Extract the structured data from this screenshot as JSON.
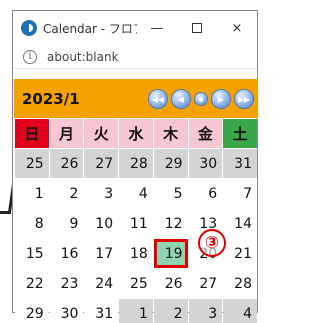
{
  "window": {
    "title": "Calendar - フロフ...",
    "minimize_glyph": "—",
    "close_glyph": "×",
    "url": "about:blank",
    "info_glyph": "i"
  },
  "calendar": {
    "month_label": "2023/1",
    "nav": {
      "first_glyph": "◀◀",
      "prev_glyph": "◀",
      "today_glyph": "●",
      "next_glyph": "▶",
      "last_glyph": "▶▶"
    },
    "weekdays": [
      "日",
      "月",
      "火",
      "水",
      "木",
      "金",
      "土"
    ],
    "weeks": [
      [
        "25",
        "26",
        "27",
        "28",
        "29",
        "30",
        "31"
      ],
      [
        "1",
        "2",
        "3",
        "4",
        "5",
        "6",
        "7"
      ],
      [
        "8",
        "9",
        "10",
        "11",
        "12",
        "13",
        "14"
      ],
      [
        "15",
        "16",
        "17",
        "18",
        "19",
        "20",
        "21"
      ],
      [
        "22",
        "23",
        "24",
        "25",
        "26",
        "27",
        "28"
      ],
      [
        "29",
        "30",
        "31",
        "1",
        "2",
        "3",
        "4"
      ]
    ],
    "selected_day": "19",
    "colors": {
      "header": "#f5a100",
      "sunday": "#e0001a",
      "saturday": "#3aa84a",
      "weekday_header": "#f6c7d2",
      "other_month": "#d4d4d4",
      "selected_fill": "#8fd6b0",
      "highlight": "#e00000"
    }
  },
  "annotation": {
    "callout_label": "③"
  }
}
